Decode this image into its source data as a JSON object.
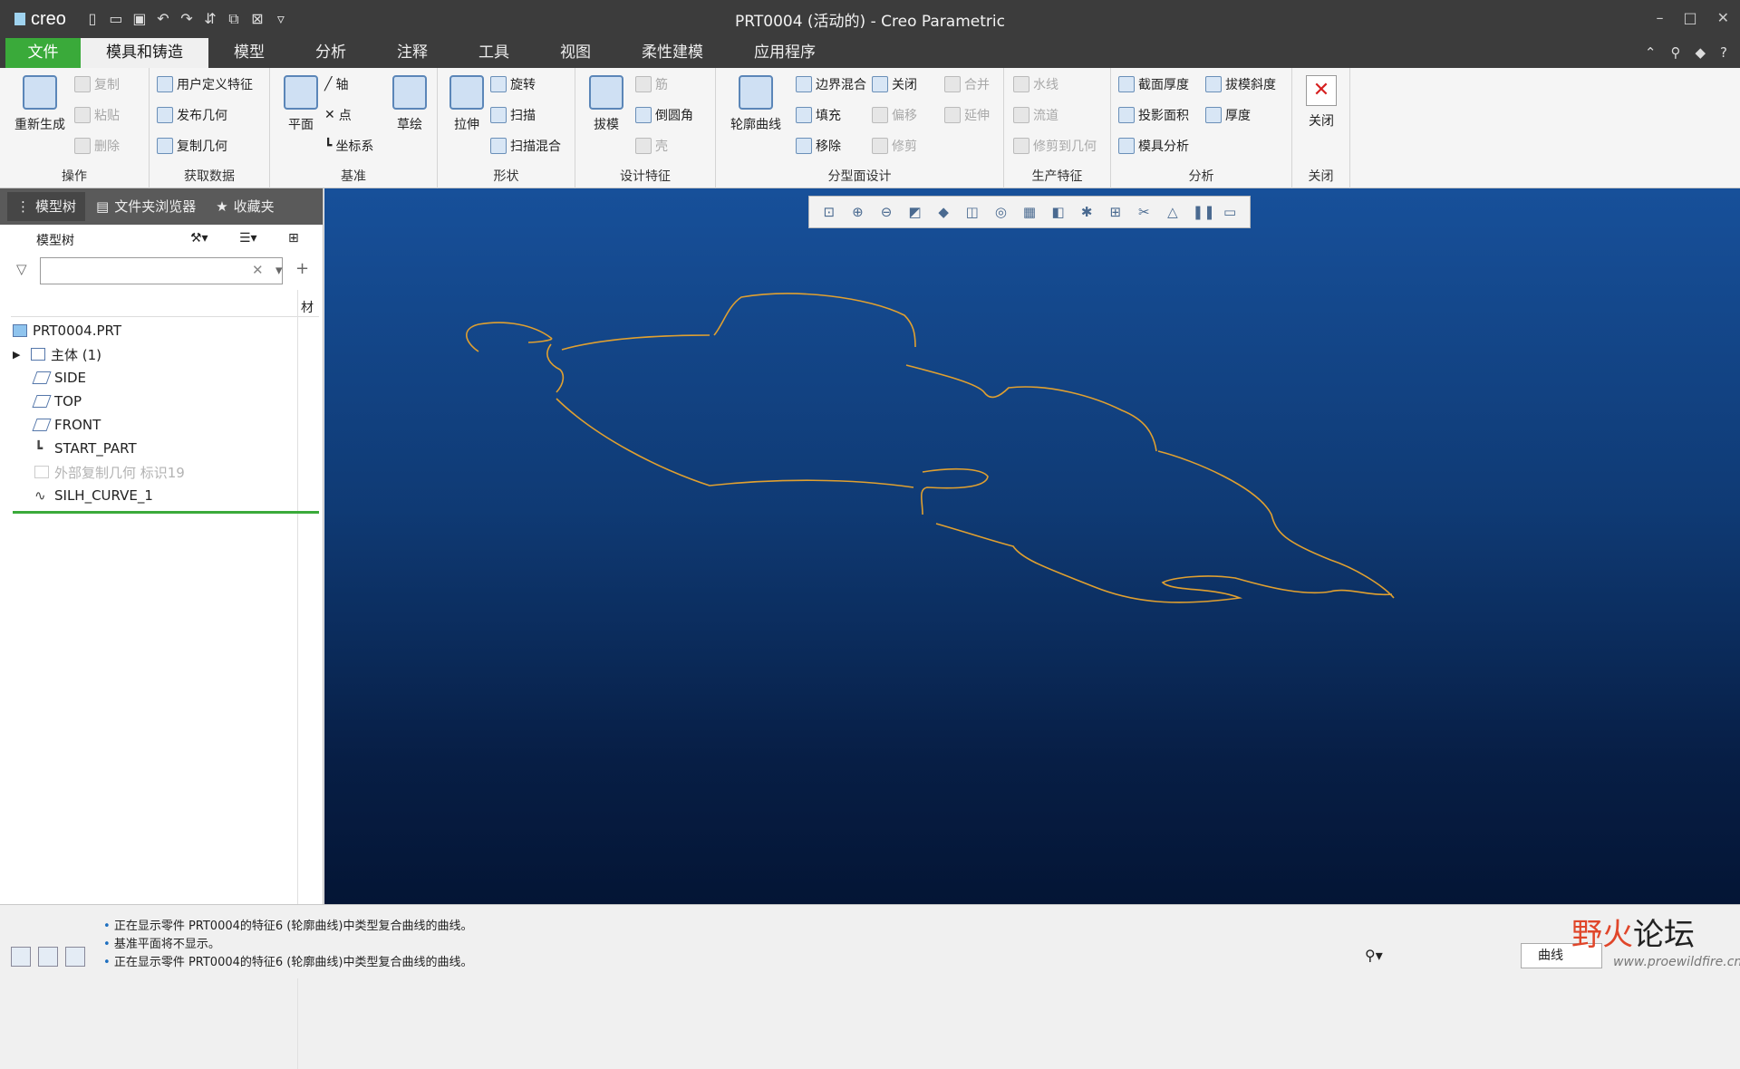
{
  "app": {
    "logo": "creo",
    "title": "PRT0004 (活动的) - Creo Parametric"
  },
  "window_controls": {
    "minimize": "–",
    "maximize": "□",
    "close": "✕"
  },
  "tabs": [
    {
      "label": "文件"
    },
    {
      "label": "模具和铸造"
    },
    {
      "label": "模型"
    },
    {
      "label": "分析"
    },
    {
      "label": "注释"
    },
    {
      "label": "工具"
    },
    {
      "label": "视图"
    },
    {
      "label": "柔性建模"
    },
    {
      "label": "应用程序"
    }
  ],
  "ribbon": {
    "ops": {
      "regen": "重新生成",
      "copy": "复制",
      "paste": "粘贴",
      "delete": "删除",
      "group": "操作"
    },
    "getdata": {
      "udf": "用户定义特征",
      "publish": "发布几何",
      "copygeom": "复制几何",
      "group": "获取数据"
    },
    "datum": {
      "plane": "平面",
      "axis": "轴",
      "point": "点",
      "csys": "坐标系",
      "sketch": "草绘",
      "group": "基准"
    },
    "shape": {
      "extrude": "拉伸",
      "revolve": "旋转",
      "sweep": "扫描",
      "sweepblend": "扫描混合",
      "group": "形状"
    },
    "eng": {
      "draft": "拔模",
      "rib": "筋",
      "round": "倒圆角",
      "shell": "壳",
      "group": "设计特征"
    },
    "parting": {
      "silh": "轮廓曲线",
      "boundary": "边界混合",
      "fill": "填充",
      "remove": "移除",
      "closeb": "关闭",
      "offset": "偏移",
      "trim": "修剪",
      "merge": "合并",
      "extend": "延伸",
      "group": "分型面设计"
    },
    "prod": {
      "waterline": "水线",
      "runner": "流道",
      "trimto": "修剪到几何",
      "group": "生产特征"
    },
    "analysis": {
      "secthick": "截面厚度",
      "draftcheck": "拔模斜度",
      "projarea": "投影面积",
      "thick": "厚度",
      "moldanalysis": "模具分析",
      "group": "分析"
    },
    "closegrp": {
      "close": "关闭",
      "group": "关闭"
    }
  },
  "panel": {
    "tabs": [
      "模型树",
      "文件夹浏览器",
      "收藏夹"
    ],
    "tree_title": "模型树",
    "search_placeholder": "",
    "column_header": "材",
    "nodes": [
      {
        "label": "PRT0004.PRT",
        "enabled": true
      },
      {
        "label": "主体 (1)",
        "enabled": true
      },
      {
        "label": "SIDE",
        "enabled": true
      },
      {
        "label": "TOP",
        "enabled": true
      },
      {
        "label": "FRONT",
        "enabled": true
      },
      {
        "label": "START_PART",
        "enabled": true
      },
      {
        "label": "外部复制几何 标识19",
        "enabled": false
      },
      {
        "label": "SILH_CURVE_1",
        "enabled": true
      }
    ]
  },
  "status": {
    "messages": [
      "正在显示零件 PRT0004的特征6 (轮廓曲线)中类型复合曲线的曲线。",
      "基准平面将不显示。",
      "正在显示零件 PRT0004的特征6 (轮廓曲线)中类型复合曲线的曲线。"
    ],
    "select_filter": "曲线"
  },
  "watermark": {
    "part1": "野火",
    "part2": "论坛",
    "url": "www.proewildfire.cn"
  },
  "colors": {
    "file_tab": "#3aaa3a",
    "curve": "#e0a030",
    "viewport_top": "#17509a",
    "viewport_bottom": "#041535"
  }
}
